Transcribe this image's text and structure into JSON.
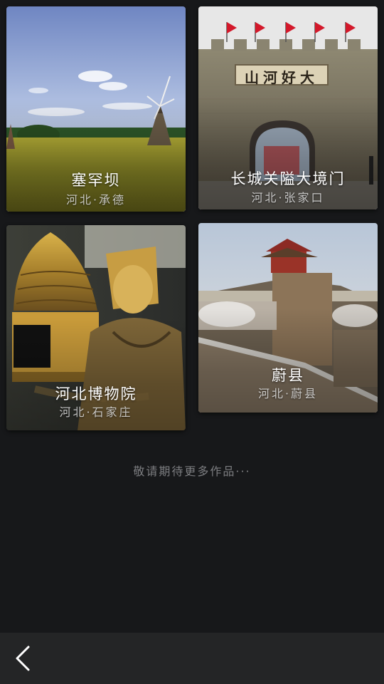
{
  "cards": [
    {
      "title": "塞罕坝",
      "subtitle": "河北·承德"
    },
    {
      "title": "长城关隘大境门",
      "subtitle": "河北·张家口",
      "gate_plaque": "山河好大"
    },
    {
      "title": "河北博物院",
      "subtitle": "河北·石家庄"
    },
    {
      "title": "蔚县",
      "subtitle": "河北·蔚县"
    }
  ],
  "footer": {
    "more_text": "敬请期待更多作品···"
  },
  "nav": {
    "back_icon": "chevron-left-icon"
  },
  "colors": {
    "background": "#17181a",
    "bottom_bar": "#242526",
    "more_text": "#7c7d80"
  }
}
